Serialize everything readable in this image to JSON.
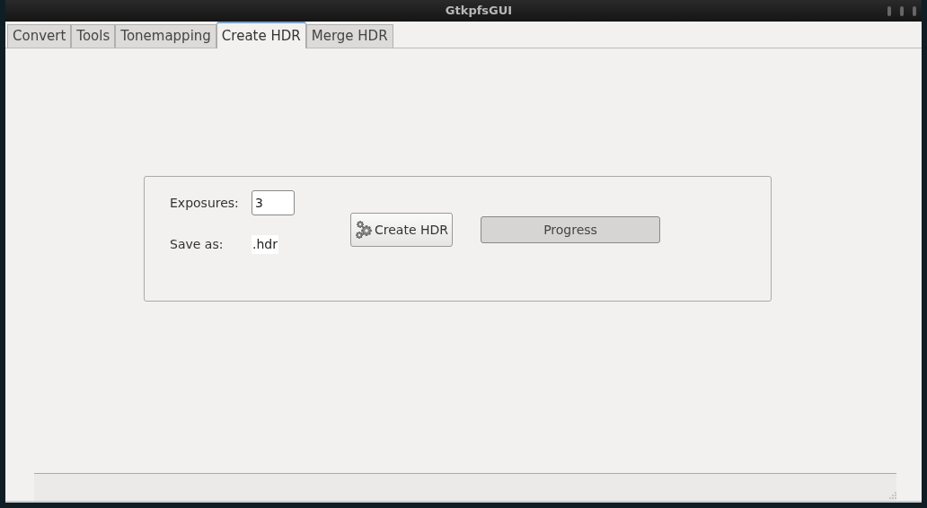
{
  "window": {
    "title": "GtkpfsGUI"
  },
  "tabs": [
    {
      "label": "Convert",
      "selected": false
    },
    {
      "label": "Tools",
      "selected": false
    },
    {
      "label": "Tonemapping",
      "selected": false
    },
    {
      "label": "Create HDR",
      "selected": true
    },
    {
      "label": "Merge HDR",
      "selected": false
    }
  ],
  "form": {
    "exposures_label": "Exposures:",
    "exposures_value": "3",
    "save_as_label": "Save as:",
    "save_as_value": ".hdr",
    "create_button": "Create HDR",
    "progress": {
      "label": "Progress",
      "level": 0
    }
  }
}
